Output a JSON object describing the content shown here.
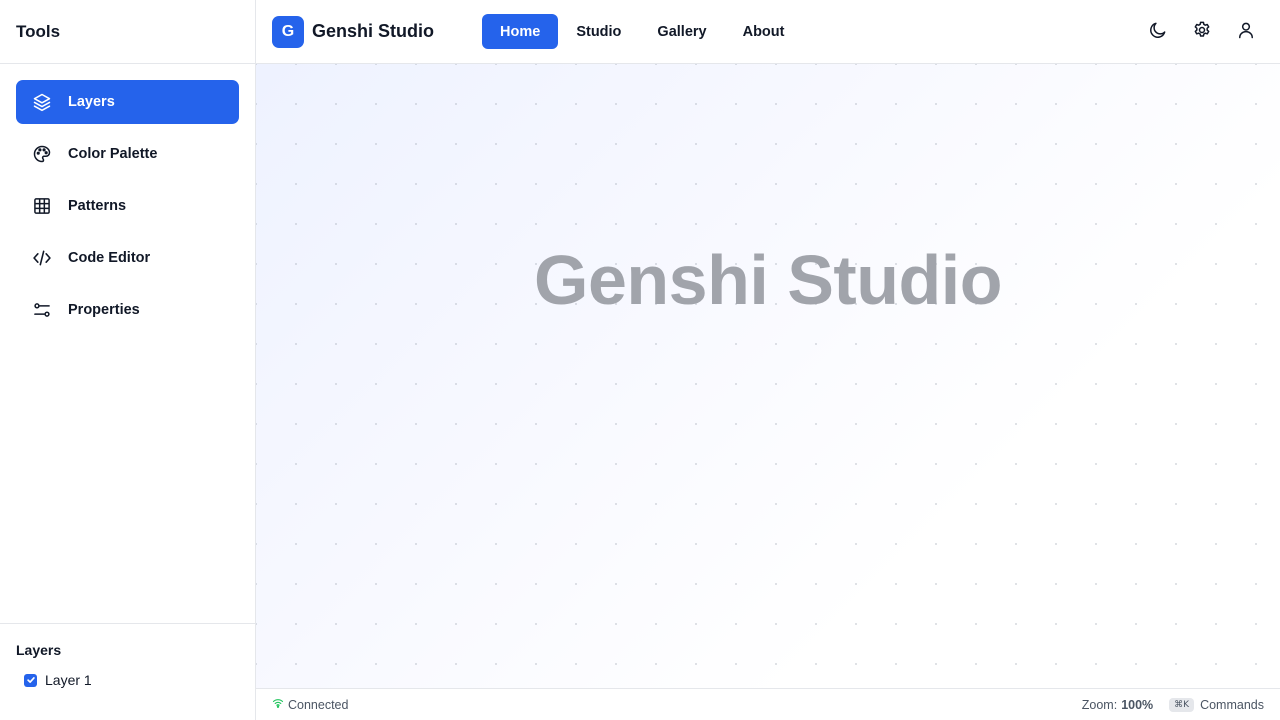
{
  "sidebar": {
    "title": "Tools",
    "items": [
      {
        "label": "Layers",
        "icon": "layers-icon",
        "active": true
      },
      {
        "label": "Color Palette",
        "icon": "palette-icon",
        "active": false
      },
      {
        "label": "Patterns",
        "icon": "grid-icon",
        "active": false
      },
      {
        "label": "Code Editor",
        "icon": "code-icon",
        "active": false
      },
      {
        "label": "Properties",
        "icon": "sliders-icon",
        "active": false
      }
    ],
    "layers_panel": {
      "title": "Layers",
      "layers": [
        {
          "name": "Layer 1",
          "checked": true
        }
      ]
    }
  },
  "header": {
    "logo_letter": "G",
    "brand": "Genshi Studio",
    "tabs": [
      {
        "label": "Home",
        "active": true
      },
      {
        "label": "Studio",
        "active": false
      },
      {
        "label": "Gallery",
        "active": false
      },
      {
        "label": "About",
        "active": false
      }
    ],
    "actions": [
      "moon-icon",
      "gear-icon",
      "user-icon"
    ]
  },
  "canvas": {
    "title": "Genshi Studio"
  },
  "status": {
    "connection": "Connected",
    "zoom_label": "Zoom:",
    "zoom_value": "100%",
    "shortcut": "⌘K",
    "commands": "Commands"
  },
  "colors": {
    "accent": "#2563eb",
    "text": "#111827",
    "muted": "#4b5563",
    "border": "#e5e7eb",
    "connected": "#22c55e"
  }
}
